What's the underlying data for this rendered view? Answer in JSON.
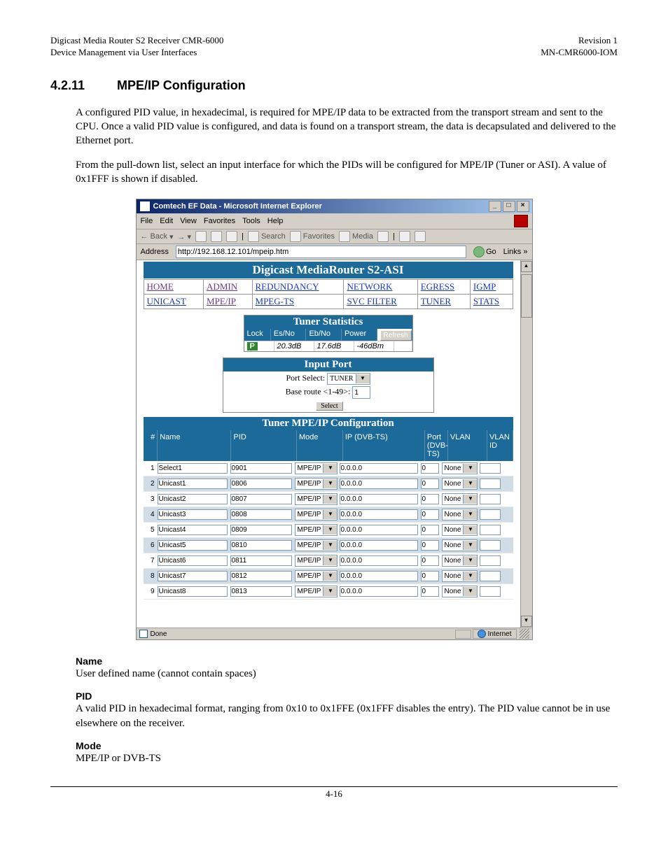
{
  "doc_header": {
    "left_line1": "Digicast Media Router S2 Receiver CMR-6000",
    "left_line2": "Device Management via User Interfaces",
    "right_line1": "Revision 1",
    "right_line2": "MN-CMR6000-IOM"
  },
  "section": {
    "number": "4.2.11",
    "title": "MPE/IP Configuration"
  },
  "paragraphs": {
    "p1": "A configured PID value, in hexadecimal, is required for MPE/IP data to be extracted from the transport stream and sent to the CPU. Once a valid PID value is configured, and data is found on a transport stream, the data is decapsulated and delivered to the Ethernet port.",
    "p2": "From the pull-down list, select an input interface for which the PIDs will be configured for MPE/IP (Tuner or ASI).  A value of 0x1FFF is shown if disabled."
  },
  "fields": {
    "name_label": "Name",
    "name_desc": "User defined name (cannot contain spaces)",
    "pid_label": "PID",
    "pid_desc": "A valid PID in hexadecimal format, ranging from 0x10 to 0x1FFE (0x1FFF disables the entry). The PID value cannot be in use elsewhere on the receiver.",
    "mode_label": "Mode",
    "mode_desc": "MPE/IP or DVB-TS"
  },
  "footer": {
    "pagenum": "4-16"
  },
  "browser": {
    "title": "Comtech EF Data - Microsoft Internet Explorer",
    "menus": [
      "File",
      "Edit",
      "View",
      "Favorites",
      "Tools",
      "Help"
    ],
    "toolbar": {
      "back": "Back",
      "search": "Search",
      "favorites": "Favorites",
      "media": "Media"
    },
    "address_label": "Address",
    "address_value": "http://192.168.12.101/mpeip.htm",
    "go": "Go",
    "links": "Links",
    "status_done": "Done",
    "status_zone": "Internet"
  },
  "webpage": {
    "title": "Digicast MediaRouter S2-ASI",
    "nav_row1": [
      "HOME",
      "ADMIN",
      "REDUNDANCY",
      "NETWORK",
      "EGRESS",
      "IGMP"
    ],
    "nav_row2": [
      "UNICAST",
      "MPE/IP",
      "MPEG-TS",
      "SVC FILTER",
      "TUNER",
      "STATS"
    ],
    "tuner": {
      "header": "Tuner Statistics",
      "cols": [
        "Lock",
        "Es/No",
        "Eb/No",
        "Power"
      ],
      "vals": [
        "P",
        "20.3dB",
        "17.6dB",
        "-46dBm"
      ],
      "refresh": "Refresh"
    },
    "input_port": {
      "header": "Input Port",
      "port_select_label": "Port Select:",
      "port_select_value": "TUNER",
      "base_route_label": "Base route <1-49>:",
      "base_route_value": "1",
      "select_btn": "Select"
    },
    "config": {
      "header": "Tuner MPE/IP Configuration",
      "cols": {
        "num": "#",
        "name": "Name",
        "pid": "PID",
        "mode": "Mode",
        "ip": "IP (DVB-TS)",
        "port": "Port (DVB-TS)",
        "vlan": "VLAN",
        "vlanid": "VLAN ID"
      },
      "mode_value": "MPE/IP",
      "vlan_value": "None",
      "rows": [
        {
          "n": "1",
          "name": "Select1",
          "pid": "0901",
          "ip": "0.0.0.0",
          "port": "0"
        },
        {
          "n": "2",
          "name": "Unicast1",
          "pid": "0806",
          "ip": "0.0.0.0",
          "port": "0"
        },
        {
          "n": "3",
          "name": "Unicast2",
          "pid": "0807",
          "ip": "0.0.0.0",
          "port": "0"
        },
        {
          "n": "4",
          "name": "Unicast3",
          "pid": "0808",
          "ip": "0.0.0.0",
          "port": "0"
        },
        {
          "n": "5",
          "name": "Unicast4",
          "pid": "0809",
          "ip": "0.0.0.0",
          "port": "0"
        },
        {
          "n": "6",
          "name": "Unicast5",
          "pid": "0810",
          "ip": "0.0.0.0",
          "port": "0"
        },
        {
          "n": "7",
          "name": "Unicast6",
          "pid": "0811",
          "ip": "0.0.0.0",
          "port": "0"
        },
        {
          "n": "8",
          "name": "Unicast7",
          "pid": "0812",
          "ip": "0.0.0.0",
          "port": "0"
        },
        {
          "n": "9",
          "name": "Unicast8",
          "pid": "0813",
          "ip": "0.0.0.0",
          "port": "0"
        }
      ]
    }
  }
}
